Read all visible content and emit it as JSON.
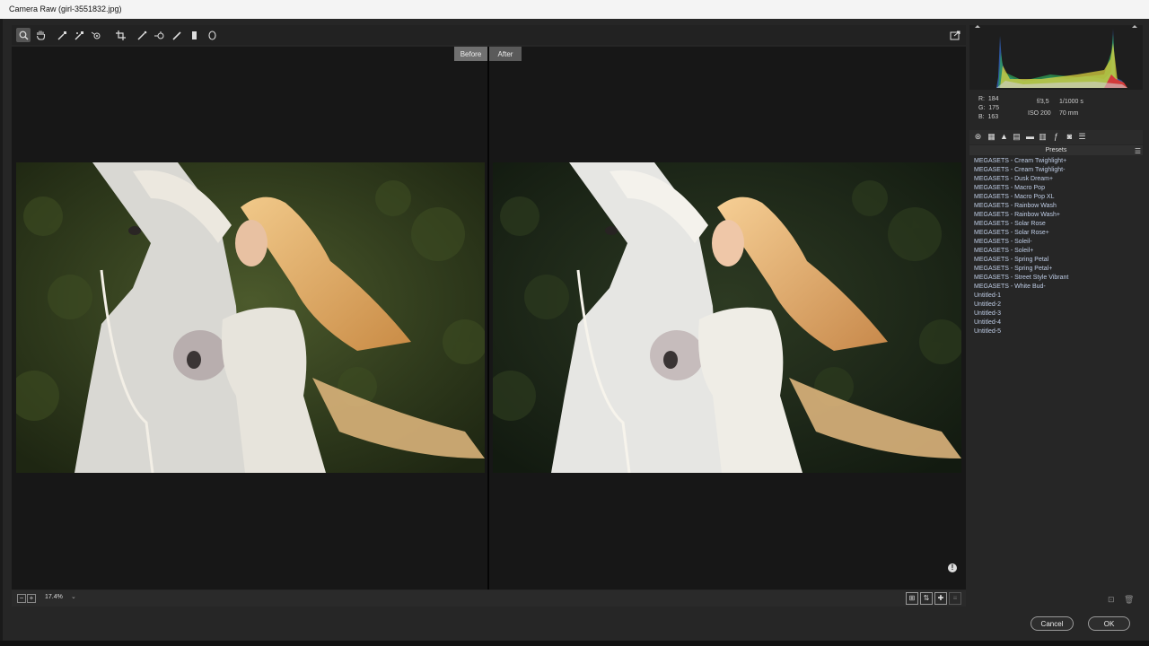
{
  "window": {
    "title": "Camera Raw (girl-3551832.jpg)"
  },
  "toolbar": {
    "tools": [
      {
        "name": "zoom-tool-icon",
        "glyph": "⌕"
      },
      {
        "name": "hand-tool-icon",
        "glyph": "✋"
      },
      {
        "name": "white-balance-tool-icon",
        "glyph": "⟋"
      },
      {
        "name": "color-sampler-tool-icon",
        "glyph": "⟋"
      },
      {
        "name": "targeted-adjustment-tool-icon",
        "glyph": "◎"
      },
      {
        "name": "crop-tool-icon",
        "glyph": "⌗"
      },
      {
        "name": "spot-removal-tool-icon",
        "glyph": "✎"
      },
      {
        "name": "red-eye-tool-icon",
        "glyph": "⊕"
      },
      {
        "name": "adjustment-brush-icon",
        "glyph": "/"
      },
      {
        "name": "graduated-filter-icon",
        "glyph": "▮"
      },
      {
        "name": "radial-filter-icon",
        "glyph": "○"
      }
    ],
    "open_preferences_icon": "export-icon"
  },
  "view": {
    "before_label": "Before",
    "after_label": "After",
    "zoom_value": "17.4%"
  },
  "readout": {
    "r_label": "R:",
    "r_value": "184",
    "g_label": "G:",
    "g_value": "175",
    "b_label": "B:",
    "b_value": "163",
    "aperture": "f/3,5",
    "shutter": "1/1000 s",
    "iso": "ISO 200",
    "focal": "70 mm"
  },
  "presets": {
    "heading": "Presets",
    "items": [
      "MEGASETS - Cream Twighlight+",
      "MEGASETS - Cream Twighlight-",
      "MEGASETS - Dusk Dream+",
      "MEGASETS - Macro Pop",
      "MEGASETS - Macro Pop XL",
      "MEGASETS - Rainbow Wash",
      "MEGASETS - Rainbow Wash+",
      "MEGASETS - Solar Rose",
      "MEGASETS - Solar Rose+",
      "MEGASETS - Soleil-",
      "MEGASETS - Soleil+",
      "MEGASETS - Spring Petal",
      "MEGASETS - Spring Petal+",
      "MEGASETS - Street Style Vibrant",
      "MEGASETS - White Bud-",
      "Untitled-1",
      "Untitled-2",
      "Untitled-3",
      "Untitled-4",
      "Untitled-5"
    ]
  },
  "footer": {
    "cancel_label": "Cancel",
    "ok_label": "OK"
  },
  "colors": {
    "preset_text": "#bfcde6",
    "canvas_bg": "#171717"
  }
}
